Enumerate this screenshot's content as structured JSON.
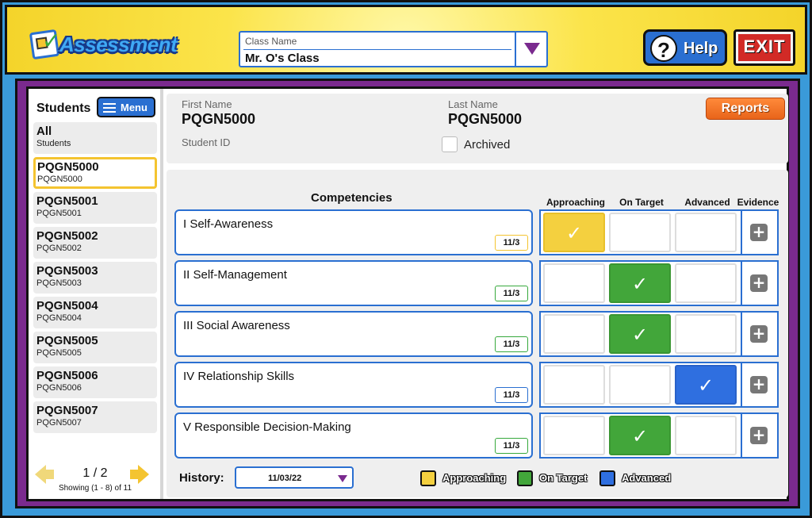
{
  "header": {
    "logo_text": "Assessment",
    "class_select": {
      "label": "Class Name",
      "value": "Mr. O's Class"
    },
    "help_label": "Help",
    "exit_label": "EXIT"
  },
  "sidebar": {
    "title": "Students",
    "menu_label": "Menu",
    "students": [
      {
        "name": "All",
        "sub": "Students"
      },
      {
        "name": "PQGN5000",
        "sub": "PQGN5000",
        "selected": true
      },
      {
        "name": "PQGN5001",
        "sub": "PQGN5001"
      },
      {
        "name": "PQGN5002",
        "sub": "PQGN5002"
      },
      {
        "name": "PQGN5003",
        "sub": "PQGN5003"
      },
      {
        "name": "PQGN5004",
        "sub": "PQGN5004"
      },
      {
        "name": "PQGN5005",
        "sub": "PQGN5005"
      },
      {
        "name": "PQGN5006",
        "sub": "PQGN5006"
      },
      {
        "name": "PQGN5007",
        "sub": "PQGN5007"
      }
    ],
    "pager": {
      "page": "1 / 2",
      "showing": "Showing (1 - 8) of 11"
    }
  },
  "student_info": {
    "first_name_label": "First Name",
    "first_name": "PQGN5000",
    "last_name_label": "Last Name",
    "last_name": "PQGN5000",
    "student_id_label": "Student ID",
    "archived_label": "Archived",
    "reports_label": "Reports"
  },
  "competencies": {
    "title": "Competencies",
    "columns": [
      "Approaching",
      "On Target",
      "Advanced",
      "Evidence"
    ],
    "rows": [
      {
        "name": "I Self-Awareness",
        "date": "11/3",
        "rating": "Approaching"
      },
      {
        "name": "II Self-Management",
        "date": "11/3",
        "rating": "On Target"
      },
      {
        "name": "III Social Awareness",
        "date": "11/3",
        "rating": "On Target"
      },
      {
        "name": "IV Relationship Skills",
        "date": "11/3",
        "rating": "Advanced"
      },
      {
        "name": "V Responsible Decision-Making",
        "date": "11/3",
        "rating": "On Target"
      }
    ],
    "check_glyph": "✓",
    "evidence_glyph": "+"
  },
  "footer": {
    "history_label": "History:",
    "history_value": "11/03/22",
    "legend": [
      {
        "label": "Approaching",
        "color": "#f4d03f"
      },
      {
        "label": "On Target",
        "color": "#42a63a"
      },
      {
        "label": "Advanced",
        "color": "#2f6fe0"
      }
    ]
  }
}
